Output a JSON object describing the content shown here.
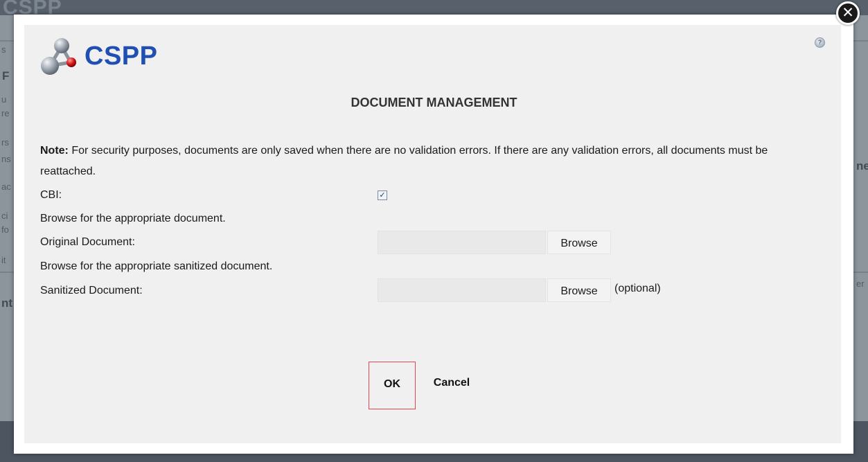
{
  "background": {
    "logo_text": "CSPP",
    "fragments": [
      "s",
      "F",
      "u",
      "re",
      "rs",
      "ns",
      "ac",
      "ci",
      "fo",
      "it",
      "nt",
      "ne",
      "er"
    ]
  },
  "dialog": {
    "brand": "CSPP",
    "title": "DOCUMENT MANAGEMENT",
    "help_icon_glyph": "?",
    "close_icon_glyph": "✕",
    "note_label": "Note:",
    "note_text": "For security purposes, documents are only saved when there are no validation errors. If there are any validation errors, all documents must be reattached.",
    "cbi_label": "CBI:",
    "cbi_checked": true,
    "checkbox_glyph": "✓",
    "browse_original_hint": "Browse for the appropriate document.",
    "original_label": "Original Document:",
    "original_value": "",
    "browse_sanitized_hint": "Browse for the appropriate sanitized document.",
    "sanitized_label": "Sanitized Document:",
    "sanitized_value": "",
    "browse_label": "Browse",
    "optional_text": "(optional)",
    "ok_label": "OK",
    "cancel_label": "Cancel"
  },
  "colors": {
    "brand_blue": "#1f4fb3",
    "ok_focus_border": "#e0464f",
    "dialog_bg": "#f0f0f0",
    "overlay": "#8c949c"
  }
}
